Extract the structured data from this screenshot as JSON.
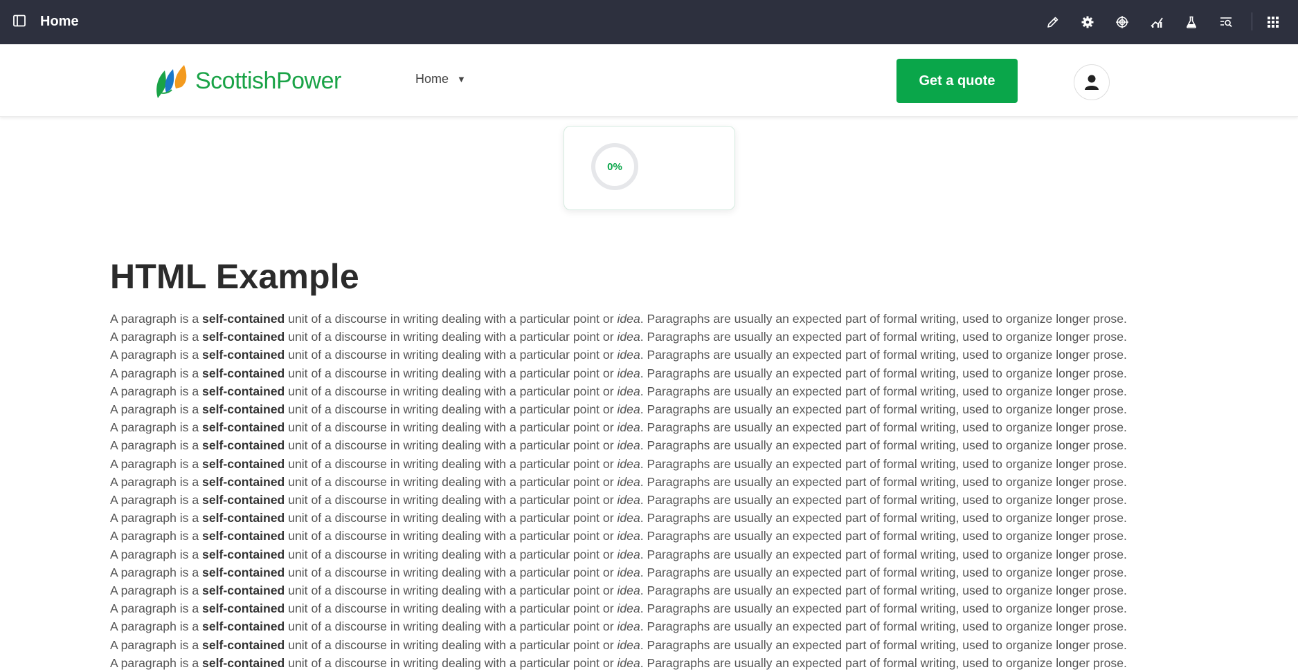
{
  "topbar": {
    "title": "Home",
    "tools": [
      "pencil-icon",
      "gear-icon",
      "target-icon",
      "chart-icon",
      "flask-icon",
      "search-list-icon",
      "grid-icon"
    ]
  },
  "header": {
    "logo_text": "ScottishPower",
    "nav_home": "Home",
    "quote_button": "Get a quote"
  },
  "progress": {
    "label": "0%",
    "value": 0
  },
  "content": {
    "heading": "HTML Example",
    "paragraph": {
      "before_bold": "A paragraph is a ",
      "bold": "self-contained",
      "middle": " unit of a discourse in writing dealing with a particular point or ",
      "italic": "idea",
      "after": ". Paragraphs are usually an expected part of formal writing, used to organize longer prose."
    },
    "paragraph_count": 20
  },
  "colors": {
    "topbar": "#2d303e",
    "accent_green": "#0aa64a",
    "logo_blue": "#1b78c8",
    "logo_orange": "#f39a1e"
  }
}
